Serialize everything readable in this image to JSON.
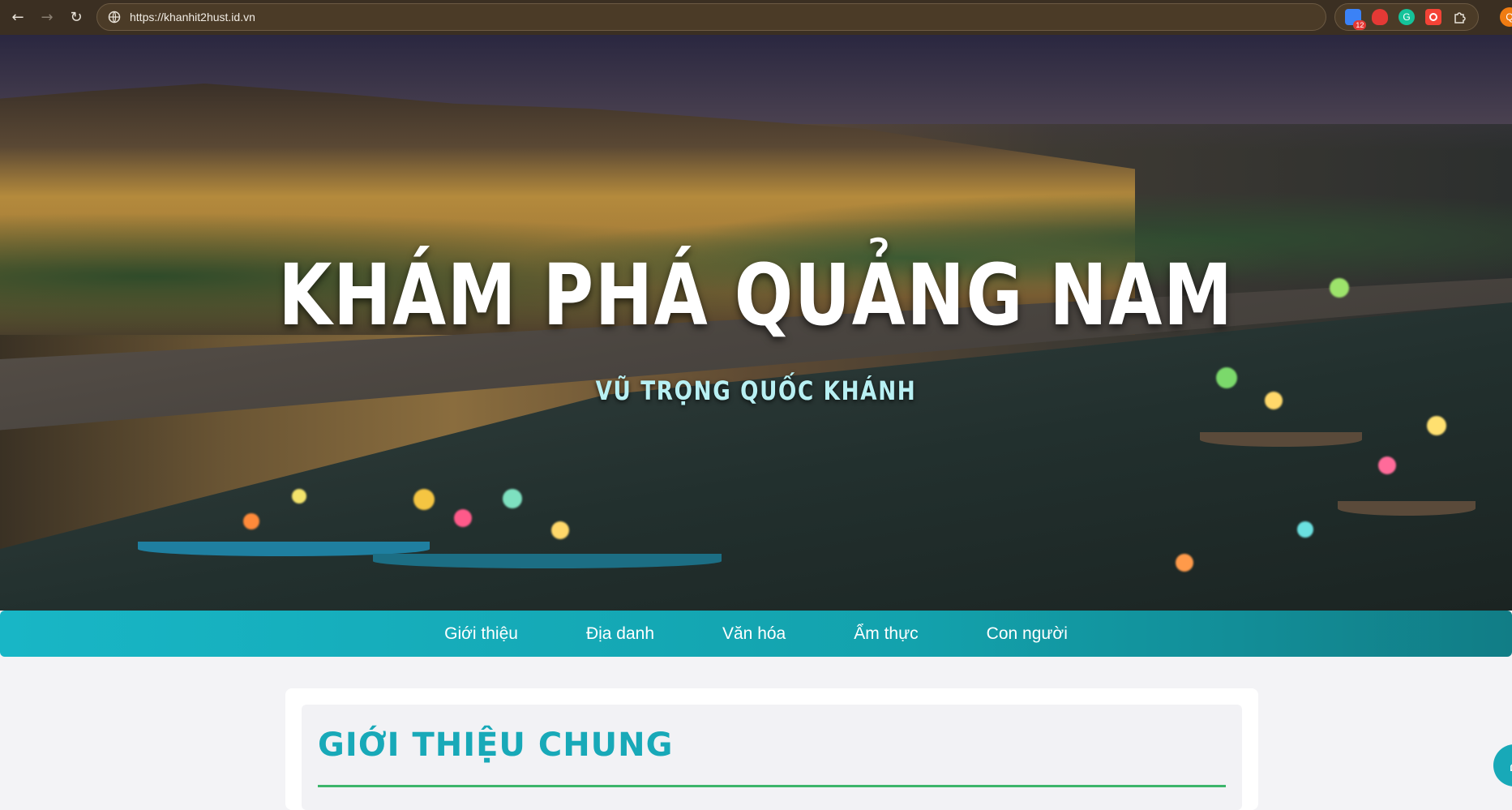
{
  "browser": {
    "back_icon": "arrow-left-icon",
    "forward_icon": "arrow-right-icon",
    "reload_icon": "reload-icon",
    "url": "https://khanhit2hust.id.vn",
    "extensions": [
      {
        "name": "tab-manager-icon",
        "badge": "12",
        "color": "#3b82f6"
      },
      {
        "name": "adblock-icon",
        "badge": "",
        "color": "#e53935"
      },
      {
        "name": "grammarly-icon",
        "badge": "",
        "color": "#15c39a"
      },
      {
        "name": "record-icon",
        "badge": "",
        "color": "#f44336"
      },
      {
        "name": "puzzle-icon",
        "badge": "",
        "color": "#cfc6b8"
      }
    ],
    "profile_initial": "Q"
  },
  "hero": {
    "title": "KHÁM PHÁ QUẢNG NAM",
    "subtitle": "VŨ TRỌNG QUỐC KHÁNH"
  },
  "nav": {
    "items": [
      {
        "label": "Giới thiệu"
      },
      {
        "label": "Địa danh"
      },
      {
        "label": "Văn hóa"
      },
      {
        "label": "Ẩm thực"
      },
      {
        "label": "Con người"
      }
    ]
  },
  "section": {
    "title": "GIỚI THIỆU CHUNG"
  },
  "colors": {
    "nav_start": "#18b6c6",
    "nav_end": "#117d86",
    "title_accent": "#18a9b8",
    "rule_accent": "#3cb56a"
  }
}
